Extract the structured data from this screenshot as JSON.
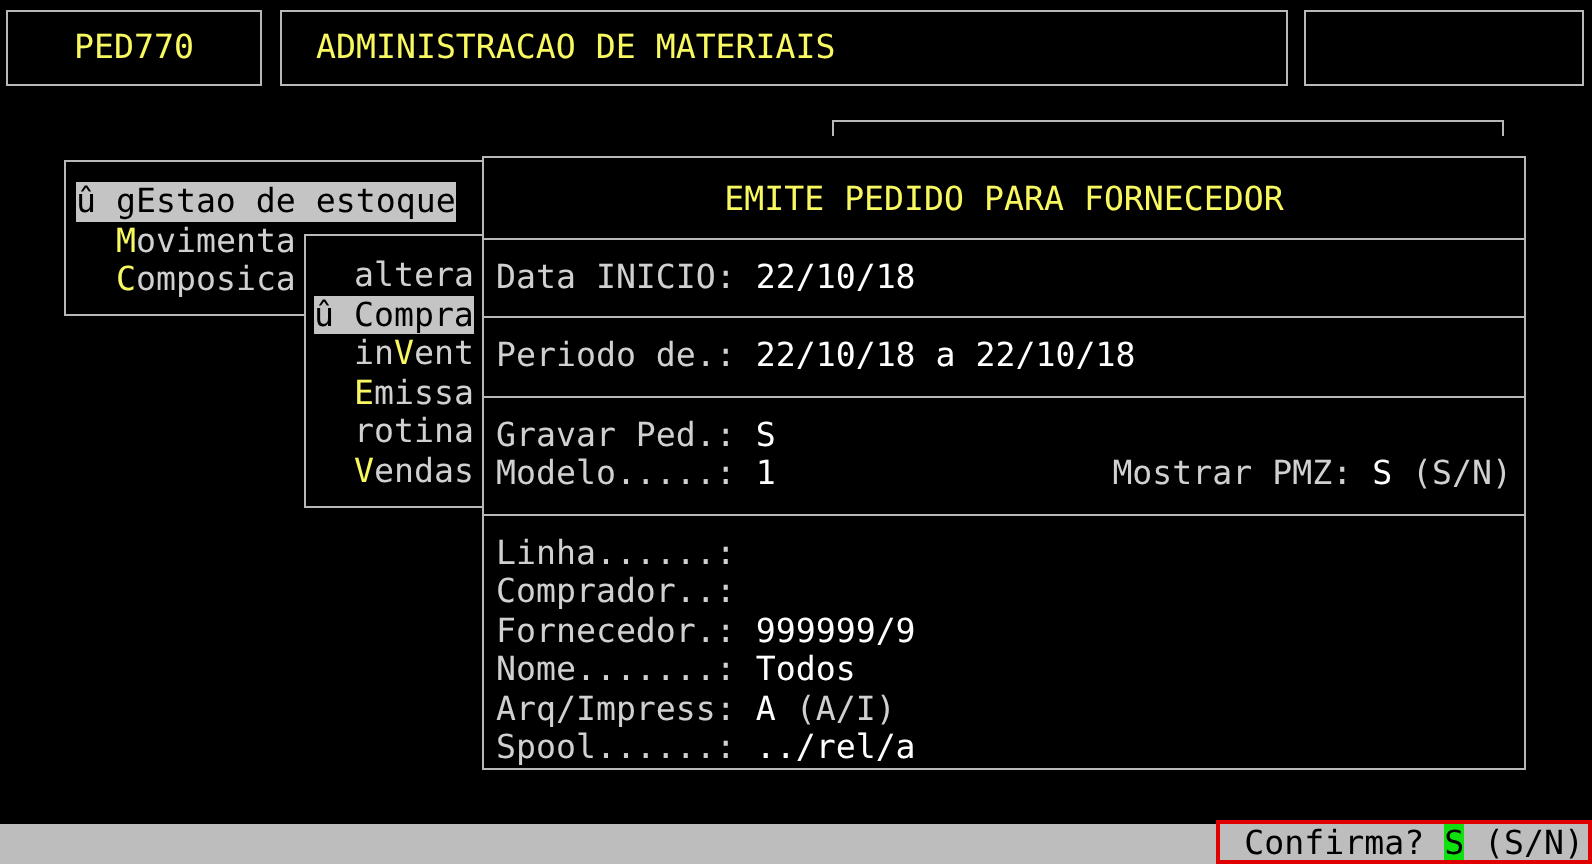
{
  "header": {
    "program": "PED770",
    "title": "ADMINISTRACAO DE MATERIAIS"
  },
  "menu": {
    "items": [
      {
        "prefix": "û gEstao de estoque",
        "selected": true
      },
      {
        "hotkey": "M",
        "suffix": "ovimenta",
        "selected": false
      },
      {
        "hotkey": "C",
        "suffix": "omposica",
        "selected": false
      }
    ]
  },
  "submenu": {
    "items": [
      {
        "prefix": "altera",
        "selected": false
      },
      {
        "prefix": "û Compra",
        "selected": true
      },
      {
        "prefix": "in",
        "hotkey": "V",
        "suffix": "ent",
        "selected": false
      },
      {
        "hotkey": "E",
        "suffix": "missa",
        "selected": false
      },
      {
        "prefix": "rotina",
        "selected": false
      },
      {
        "hotkey": "V",
        "suffix": "endas",
        "selected": false
      }
    ]
  },
  "dialog": {
    "title": "EMITE PEDIDO PARA FORNECEDOR",
    "sections": [
      {
        "fields": [
          {
            "label": "Data INICIO:",
            "value": "22/10/18"
          }
        ]
      },
      {
        "fields": [
          {
            "label": "Periodo de.:",
            "value": "22/10/18 a 22/10/18"
          }
        ]
      },
      {
        "fields": [
          {
            "label": "Gravar Ped.:",
            "value": "S"
          },
          {
            "label": "Modelo.....:",
            "value": "1",
            "extra": {
              "label": "Mostrar PMZ:",
              "value": "S",
              "hint": "(S/N)"
            }
          }
        ]
      },
      {
        "fields": [
          {
            "label": "Linha......:"
          },
          {
            "label": "Comprador..:"
          },
          {
            "label": "Fornecedor.:",
            "value": "999999/9"
          },
          {
            "label": "Nome.......:",
            "value": "Todos"
          },
          {
            "label": "Arq/Impress:",
            "value": "A",
            "hint": "(A/I)"
          },
          {
            "label": "Spool......:",
            "value": "../rel/a"
          }
        ]
      }
    ]
  },
  "status_bar": {
    "prompt": "Confirma?",
    "value": "S",
    "hint": "(S/N)"
  }
}
